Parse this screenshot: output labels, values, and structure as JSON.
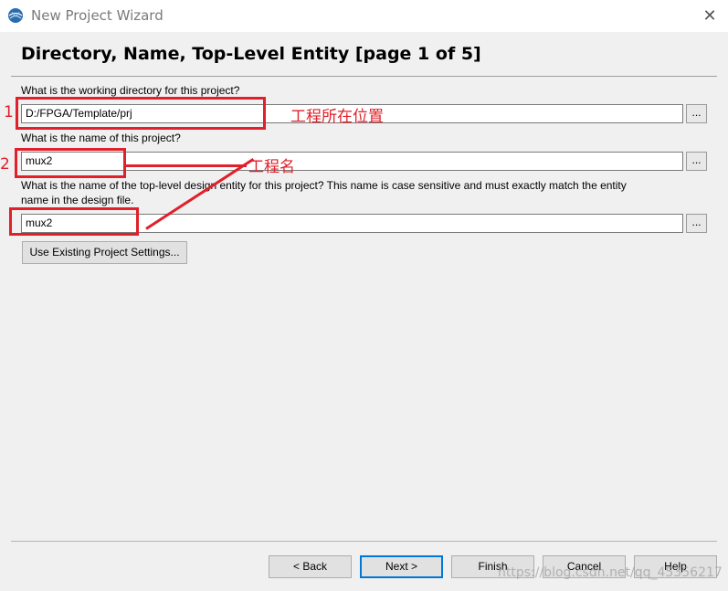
{
  "window": {
    "title": "New Project Wizard",
    "close_glyph": "✕",
    "icon": "quartus-globe-icon"
  },
  "page": {
    "header": "Directory, Name, Top-Level Entity [page 1 of 5]"
  },
  "fields": {
    "working_dir": {
      "label": "What is the working directory for this project?",
      "value": "D:/FPGA/Template/prj",
      "browse": "..."
    },
    "project_name": {
      "label": "What is the name of this project?",
      "value": "mux2",
      "browse": "..."
    },
    "top_entity": {
      "label_line1": "What is the name of the top-level design entity for this project? This name is case sensitive and must exactly match the entity",
      "label_line2": "name in the design file.",
      "value": "mux2",
      "browse": "..."
    }
  },
  "use_existing_button": "Use Existing Project Settings...",
  "footer": {
    "back": "< Back",
    "next": "Next >",
    "finish": "Finish",
    "cancel": "Cancel",
    "help": "Help"
  },
  "annotations": {
    "num1": "1",
    "num2": "2",
    "text1": "工程所在位置",
    "text2": "工程名",
    "color": "#e0202a"
  },
  "watermark": "https://blog.csdn.net/qq_45356217"
}
